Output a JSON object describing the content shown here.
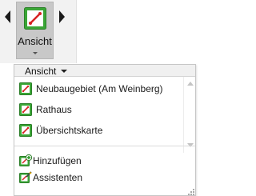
{
  "ribbon": {
    "button_label": "Ansicht",
    "nav_prev": "◀",
    "nav_next": "▶"
  },
  "dropdown": {
    "header_label": "Ansicht",
    "items": [
      {
        "label": "Neubaugebiet (Am Weinberg)",
        "icon": "map-view-icon"
      },
      {
        "label": "Rathaus",
        "icon": "map-view-icon"
      },
      {
        "label": "Übersichtskarte",
        "icon": "map-view-icon"
      }
    ],
    "commands": [
      {
        "label": "Hinzufügen",
        "icon": "add-view-icon"
      },
      {
        "label": "Assistenten",
        "icon": "wizard-icon"
      }
    ]
  },
  "colors": {
    "icon_green": "#3aa636",
    "icon_red": "#d62222",
    "button_bg": "#c8c8c8",
    "ribbon_bg": "#f2f2f2"
  }
}
